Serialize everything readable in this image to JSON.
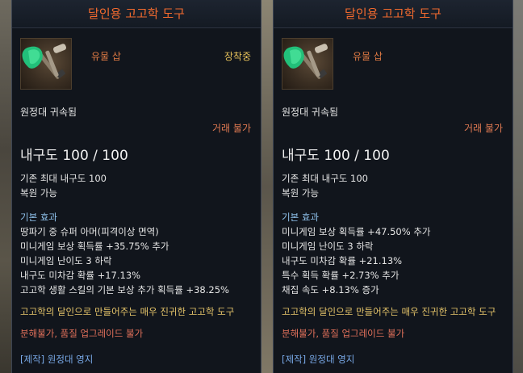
{
  "left_panel": {
    "title": "달인용 고고학 도구",
    "item_type": "유물 삽",
    "equipped_label": "장착중",
    "bound": "원정대 귀속됨",
    "trade": "거래 불가",
    "durability": "내구도 100 / 100",
    "base_lines": [
      "기존 최대 내구도 100",
      "복원 가능"
    ],
    "effects_title": "기본 효과",
    "effects": [
      "땅파기 중 슈퍼 아머(피격이상 면역)",
      "미니게임 보상 획득률 +35.75% 추가",
      "미니게임 난이도 3 하락",
      "내구도 미차감 확률 +17.13%",
      "고고학 생활 스킬의 기본 보상 추가 획득률 +38.25%"
    ],
    "description": "고고학의 달인으로 만들어주는 매우 진귀한 고고학 도구",
    "restrictions": "분해불가, 품질 업그레이드 불가",
    "craft": "[제작] 원정대 영지"
  },
  "right_panel": {
    "title": "달인용 고고학 도구",
    "item_type": "유물 삽",
    "bound": "원정대 귀속됨",
    "trade": "거래 불가",
    "durability": "내구도 100 / 100",
    "base_lines": [
      "기존 최대 내구도 100",
      "복원 가능"
    ],
    "effects_title": "기본 효과",
    "effects": [
      "미니게임 보상 획득률 +47.50% 추가",
      "미니게임 난이도 3 하락",
      "내구도 미차감 확률 +21.13%",
      "특수 획득 확률 +2.73% 추가",
      "채집 속도 +8.13% 증가"
    ],
    "description": "고고학의 달인으로 만들어주는 매우 진귀한 고고학 도구",
    "restrictions": "분해불가, 품질 업그레이드 불가",
    "craft": "[제작] 원정대 영지"
  },
  "icons": {
    "item": "shovel-icon"
  },
  "colors": {
    "title": "#f26a2e",
    "item_type": "#e07a44",
    "equipped": "#e6c15a",
    "trade": "#e27a52",
    "section": "#8ec0ea",
    "description": "#e6c56a",
    "restriction": "#e0705a",
    "craft": "#78a8e6"
  }
}
